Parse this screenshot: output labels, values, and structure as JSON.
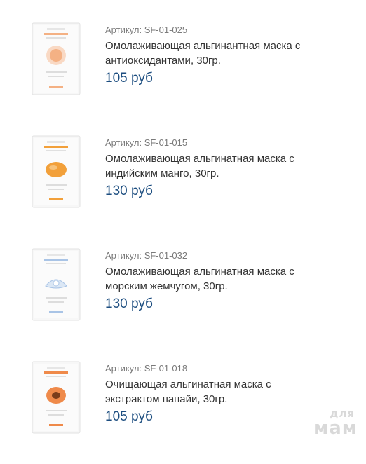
{
  "products": [
    {
      "sku": "Артикул: SF-01-025",
      "name_line1": "Омолаживающая альгинантная маска с",
      "name_line2": "антиоксидантами, 30гр.",
      "price": "105 руб",
      "accent": "#f4b184",
      "icon": "antioxidant-mask-package-icon"
    },
    {
      "sku": "Артикул: SF-01-015",
      "name_line1": "Омолаживающая альгинатная маска с",
      "name_line2": "индийским манго, 30гр.",
      "price": "130 руб",
      "accent": "#f2a03a",
      "icon": "mango-mask-package-icon"
    },
    {
      "sku": "Артикул: SF-01-032",
      "name_line1": "Омолаживающая альгинатная маска с",
      "name_line2": "морским жемчугом, 30гр.",
      "price": "130 руб",
      "accent": "#a9c4e6",
      "icon": "pearl-mask-package-icon"
    },
    {
      "sku": "Артикул: SF-01-018",
      "name_line1": "Очищающая альгинатная маска с",
      "name_line2": "экстрактом папайи, 30гр.",
      "price": "105 руб",
      "accent": "#ef8a4a",
      "icon": "papaya-mask-package-icon"
    }
  ],
  "watermark": {
    "top": "для",
    "bottom": "мам"
  }
}
